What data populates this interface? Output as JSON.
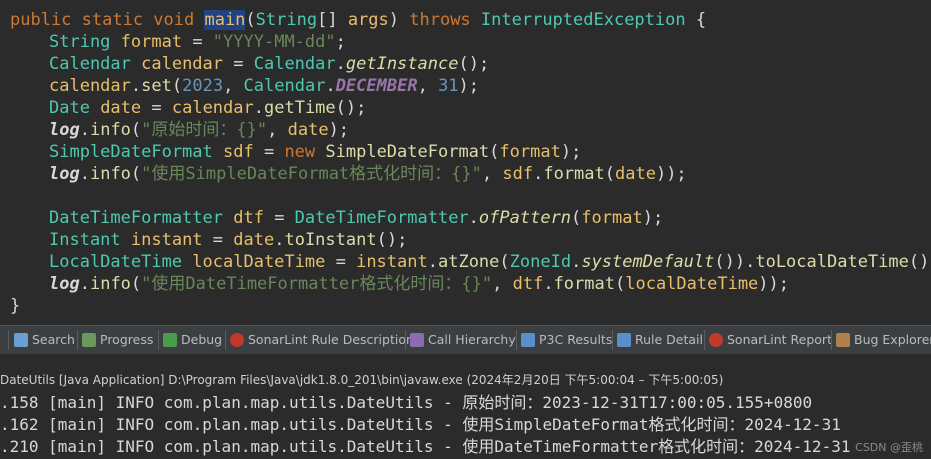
{
  "editor": {
    "lines": [
      [
        "public static void ",
        "main",
        "(",
        "String",
        "[] ",
        "args",
        ") ",
        "throws ",
        "InterruptedException",
        " {"
      ],
      [
        "String ",
        "format",
        " = ",
        "\"YYYY-MM-dd\"",
        ";"
      ],
      [
        "Calendar ",
        "calendar",
        " = ",
        "Calendar",
        ".",
        "getInstance",
        "();"
      ],
      [
        "calendar",
        ".",
        "set",
        "(",
        "2023",
        ", ",
        "Calendar",
        ".",
        "DECEMBER",
        ", ",
        "31",
        ");"
      ],
      [
        "Date ",
        "date",
        " = ",
        "calendar",
        ".",
        "getTime",
        "();"
      ],
      [
        "log",
        ".",
        "info",
        "(",
        "\"原始时间：{}\"",
        ", ",
        "date",
        ");"
      ],
      [
        "SimpleDateFormat ",
        "sdf",
        " = ",
        "new ",
        "SimpleDateFormat",
        "(",
        "format",
        ");"
      ],
      [
        "log",
        ".",
        "info",
        "(",
        "\"使用SimpleDateFormat格式化时间：{}\"",
        ", ",
        "sdf",
        ".",
        "format",
        "(",
        "date",
        "));"
      ],
      [
        "DateTimeFormatter ",
        "dtf",
        " = ",
        "DateTimeFormatter",
        ".",
        "ofPattern",
        "(",
        "format",
        ");"
      ],
      [
        "Instant ",
        "instant",
        " = ",
        "date",
        ".",
        "toInstant",
        "();"
      ],
      [
        "LocalDateTime ",
        "localDateTime",
        " = ",
        "instant",
        ".",
        "atZone",
        "(",
        "ZoneId",
        ".",
        "systemDefault",
        "()).",
        "toLocalDateTime",
        "();"
      ],
      [
        "log",
        ".",
        "info",
        "(",
        "\"使用DateTimeFormatter格式化时间：{}\"",
        ", ",
        "dtf",
        ".",
        "format",
        "(",
        "localDateTime",
        "));"
      ],
      [
        "}"
      ]
    ]
  },
  "tabs": [
    {
      "label": "Search",
      "icon": "search-icon",
      "color": "#6a9fd4"
    },
    {
      "label": "Progress",
      "icon": "progress-icon",
      "color": "#6a9a5b"
    },
    {
      "label": "Debug",
      "icon": "debug-icon",
      "color": "#4b9b4b"
    },
    {
      "label": "SonarLint Rule Description",
      "icon": "sonarlint-icon",
      "color": "#c0392b"
    },
    {
      "label": "Call Hierarchy",
      "icon": "call-hierarchy-icon",
      "color": "#8c6bb1"
    },
    {
      "label": "P3C Results",
      "icon": "p3c-icon",
      "color": "#5b8fc9"
    },
    {
      "label": "Rule Detail",
      "icon": "rule-detail-icon",
      "color": "#5b8fc9"
    },
    {
      "label": "SonarLint Report",
      "icon": "sonarlint-report-icon",
      "color": "#c0392b"
    },
    {
      "label": "Bug Explorer",
      "icon": "bug-icon",
      "color": "#b0804a"
    }
  ],
  "console": {
    "header": "DateUtils [Java Application] D:\\Program Files\\Java\\jdk1.8.0_201\\bin\\javaw.exe  (2024年2月20日 下午5:00:04 – 下午5:00:05)",
    "lines": [
      ".158 [main] INFO com.plan.map.utils.DateUtils - 原始时间：2023-12-31T17:00:05.155+0800",
      ".162 [main] INFO com.plan.map.utils.DateUtils - 使用SimpleDateFormat格式化时间：2024-12-31",
      ".210 [main] INFO com.plan.map.utils.DateUtils - 使用DateTimeFormatter格式化时间：2024-12-31"
    ],
    "watermark": "CSDN @歪桃"
  }
}
